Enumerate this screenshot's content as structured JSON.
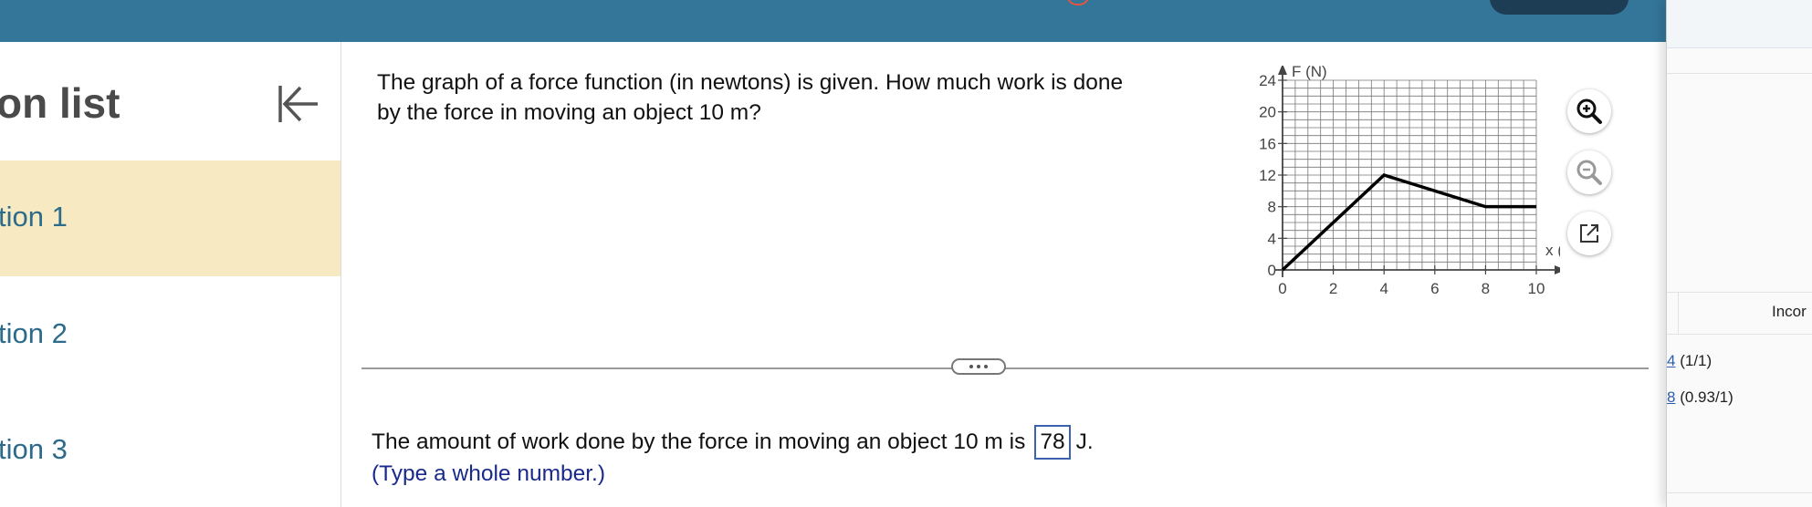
{
  "sidebar": {
    "title": "on list",
    "items": [
      {
        "label": "tion 1"
      },
      {
        "label": "tion 2"
      },
      {
        "label": "tion 3"
      }
    ]
  },
  "question": {
    "text": "The graph of a force function (in newtons) is given. How much work is done by the force in moving an object 10 m?"
  },
  "chart_data": {
    "type": "line",
    "x": [
      0,
      4,
      8,
      10
    ],
    "y": [
      0,
      12,
      8,
      8
    ],
    "xlabel": "x (m)",
    "ylabel": "F (N)",
    "xlim": [
      0,
      10
    ],
    "ylim": [
      0,
      24
    ],
    "xticks": [
      "0",
      "2",
      "4",
      "6",
      "8",
      "10"
    ],
    "yticks": [
      "0",
      "4",
      "8",
      "12",
      "16",
      "20",
      "24"
    ],
    "grid": true,
    "minor_grid_step_x": 0.5,
    "minor_grid_step_y": 1
  },
  "answer": {
    "prefix": "The amount of work done by the force in moving an object 10 m is",
    "value": "78",
    "unit": "J.",
    "hint": "(Type a whole number.)"
  },
  "right_panel": {
    "status": "Incor",
    "scores": [
      {
        "link": "4",
        "text": "(1/1)"
      },
      {
        "link": "8",
        "text": "(0.93/1)"
      }
    ]
  },
  "colors": {
    "header": "#34769a",
    "selected_item": "#f7eac3",
    "link": "#2d6b8a",
    "hint": "#1a2a8c",
    "answer_border": "#3c63b0"
  }
}
